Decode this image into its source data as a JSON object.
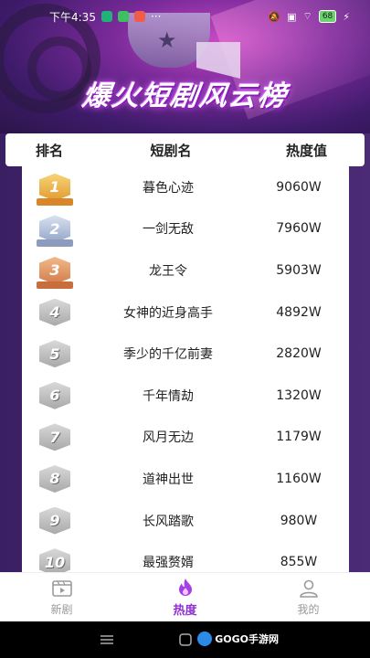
{
  "status_bar": {
    "time": "下午4:35",
    "dots": "···",
    "battery": "68"
  },
  "banner": {
    "title": "爆火短剧风云榜"
  },
  "table": {
    "headers": {
      "rank": "排名",
      "name": "短剧名",
      "heat": "热度值"
    },
    "rows": [
      {
        "rank": "1",
        "name": "暮色心迹",
        "heat": "9060W",
        "medal": "gold"
      },
      {
        "rank": "2",
        "name": "一剑无敌",
        "heat": "7960W",
        "medal": "silver"
      },
      {
        "rank": "3",
        "name": "龙王令",
        "heat": "5903W",
        "medal": "bronze"
      },
      {
        "rank": "4",
        "name": "女神的近身高手",
        "heat": "4892W",
        "medal": "plain"
      },
      {
        "rank": "5",
        "name": "季少的千亿前妻",
        "heat": "2820W",
        "medal": "plain"
      },
      {
        "rank": "6",
        "name": "千年情劫",
        "heat": "1320W",
        "medal": "plain"
      },
      {
        "rank": "7",
        "name": "风月无边",
        "heat": "1179W",
        "medal": "plain"
      },
      {
        "rank": "8",
        "name": "道神出世",
        "heat": "1160W",
        "medal": "plain"
      },
      {
        "rank": "9",
        "name": "长风踏歌",
        "heat": "980W",
        "medal": "plain"
      },
      {
        "rank": "10",
        "name": "最强赘婿",
        "heat": "855W",
        "medal": "plain"
      }
    ]
  },
  "bottom_nav": {
    "items": [
      {
        "label": "新剧",
        "icon": "film-icon",
        "active": false
      },
      {
        "label": "热度",
        "icon": "flame-icon",
        "active": true
      },
      {
        "label": "我的",
        "icon": "user-icon",
        "active": false
      }
    ]
  },
  "watermark": {
    "text": "GOGO手游网"
  },
  "colors": {
    "accent": "#8e2fd1",
    "gold": "#e19b2f",
    "silver": "#94a6c8",
    "bronze": "#d27c4a"
  }
}
